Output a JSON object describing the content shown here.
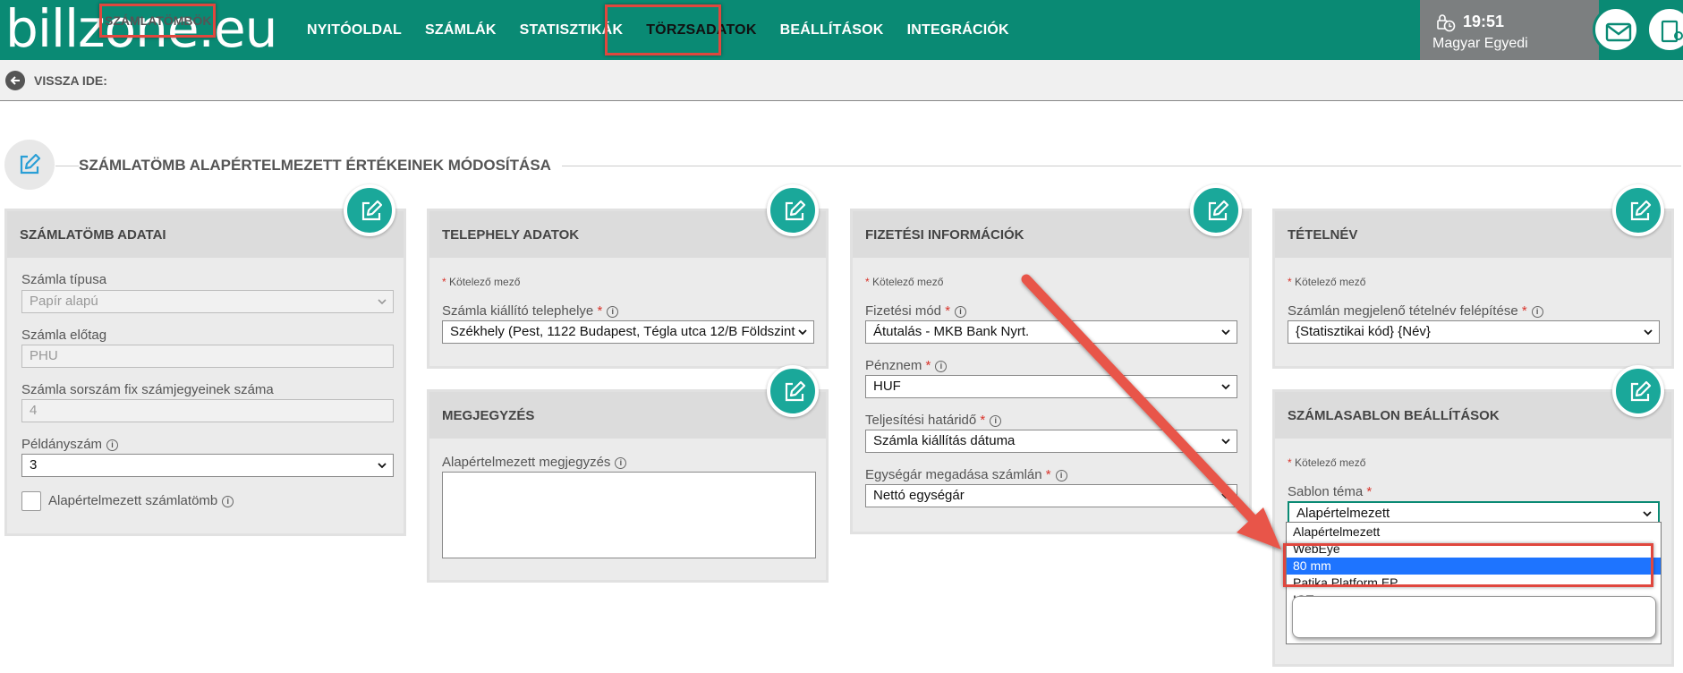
{
  "brand": {
    "logo_text": "billzone.eu"
  },
  "nav": {
    "items": [
      {
        "label": "NYITÓOLDAL"
      },
      {
        "label": "SZÁMLÁK"
      },
      {
        "label": "STATISZTIKÁK"
      },
      {
        "label": "TÖRZSADATOK"
      },
      {
        "label": "BEÁLLÍTÁSOK"
      },
      {
        "label": "INTEGRÁCIÓK"
      }
    ],
    "active": "TÖRZSADATOK"
  },
  "user": {
    "time": "19:51",
    "name": "Magyar Egyedi"
  },
  "breadcrumb": {
    "back_label": "VISSZA IDE:",
    "target_label": "SZÁMLATÖMBÖK"
  },
  "section": {
    "title": "SZÁMLATÖMB ALAPÉRTELMEZETT ÉRTÉKEINEK MÓDOSÍTÁSA"
  },
  "required_note": "Kötelező mező",
  "panels": {
    "szamlatomb": {
      "title": "SZÁMLATÖMB ADATAI",
      "invoice_type_label": "Számla típusa",
      "invoice_type_value": "Papír alapú",
      "prefix_label": "Számla előtag",
      "prefix_value": "PHU",
      "fixed_digits_label": "Számla sorszám fix számjegyeinek száma",
      "fixed_digits_value": "4",
      "copies_label": "Példányszám",
      "copies_value": "3",
      "default_checkbox_label": "Alapértelmezett számlatömb"
    },
    "telephely": {
      "title": "TELEPHELY ADATOK",
      "site_label": "Számla kiállító telephelye",
      "site_value": "Székhely (Pest, 1122 Budapest, Tégla utca 12/B Földszint"
    },
    "megjegyzes": {
      "title": "MEGJEGYZÉS",
      "note_label": "Alapértelmezett megjegyzés",
      "note_value": ""
    },
    "fizetes": {
      "title": "FIZETÉSI INFORMÁCIÓK",
      "method_label": "Fizetési mód",
      "method_value": "Átutalás - MKB Bank Nyrt.",
      "currency_label": "Pénznem",
      "currency_value": "HUF",
      "deadline_label": "Teljesítési határidő",
      "deadline_value": "Számla kiállítás dátuma",
      "unitprice_label": "Egységár megadása számlán",
      "unitprice_value": "Nettó egységár"
    },
    "tetelnev": {
      "title": "TÉTELNÉV",
      "structure_label": "Számlán megjelenő tételnév felépítése",
      "structure_value": "{Statisztikai kód} {Név}"
    },
    "sablon": {
      "title": "SZÁMLASABLON BEÁLLÍTÁSOK",
      "theme_label": "Sablon téma",
      "theme_value": "Alapértelmezett",
      "options": [
        {
          "label": "Alapértelmezett"
        },
        {
          "label": "WebEye"
        },
        {
          "label": "80 mm"
        },
        {
          "label": "Patika Platform EP"
        },
        {
          "label": "IGT"
        }
      ],
      "selected_option": "80 mm"
    }
  },
  "colors": {
    "brand": "#0a8a74",
    "accent": "#1aa89a",
    "highlight": "#e0473e",
    "selection": "#1e74ff"
  }
}
